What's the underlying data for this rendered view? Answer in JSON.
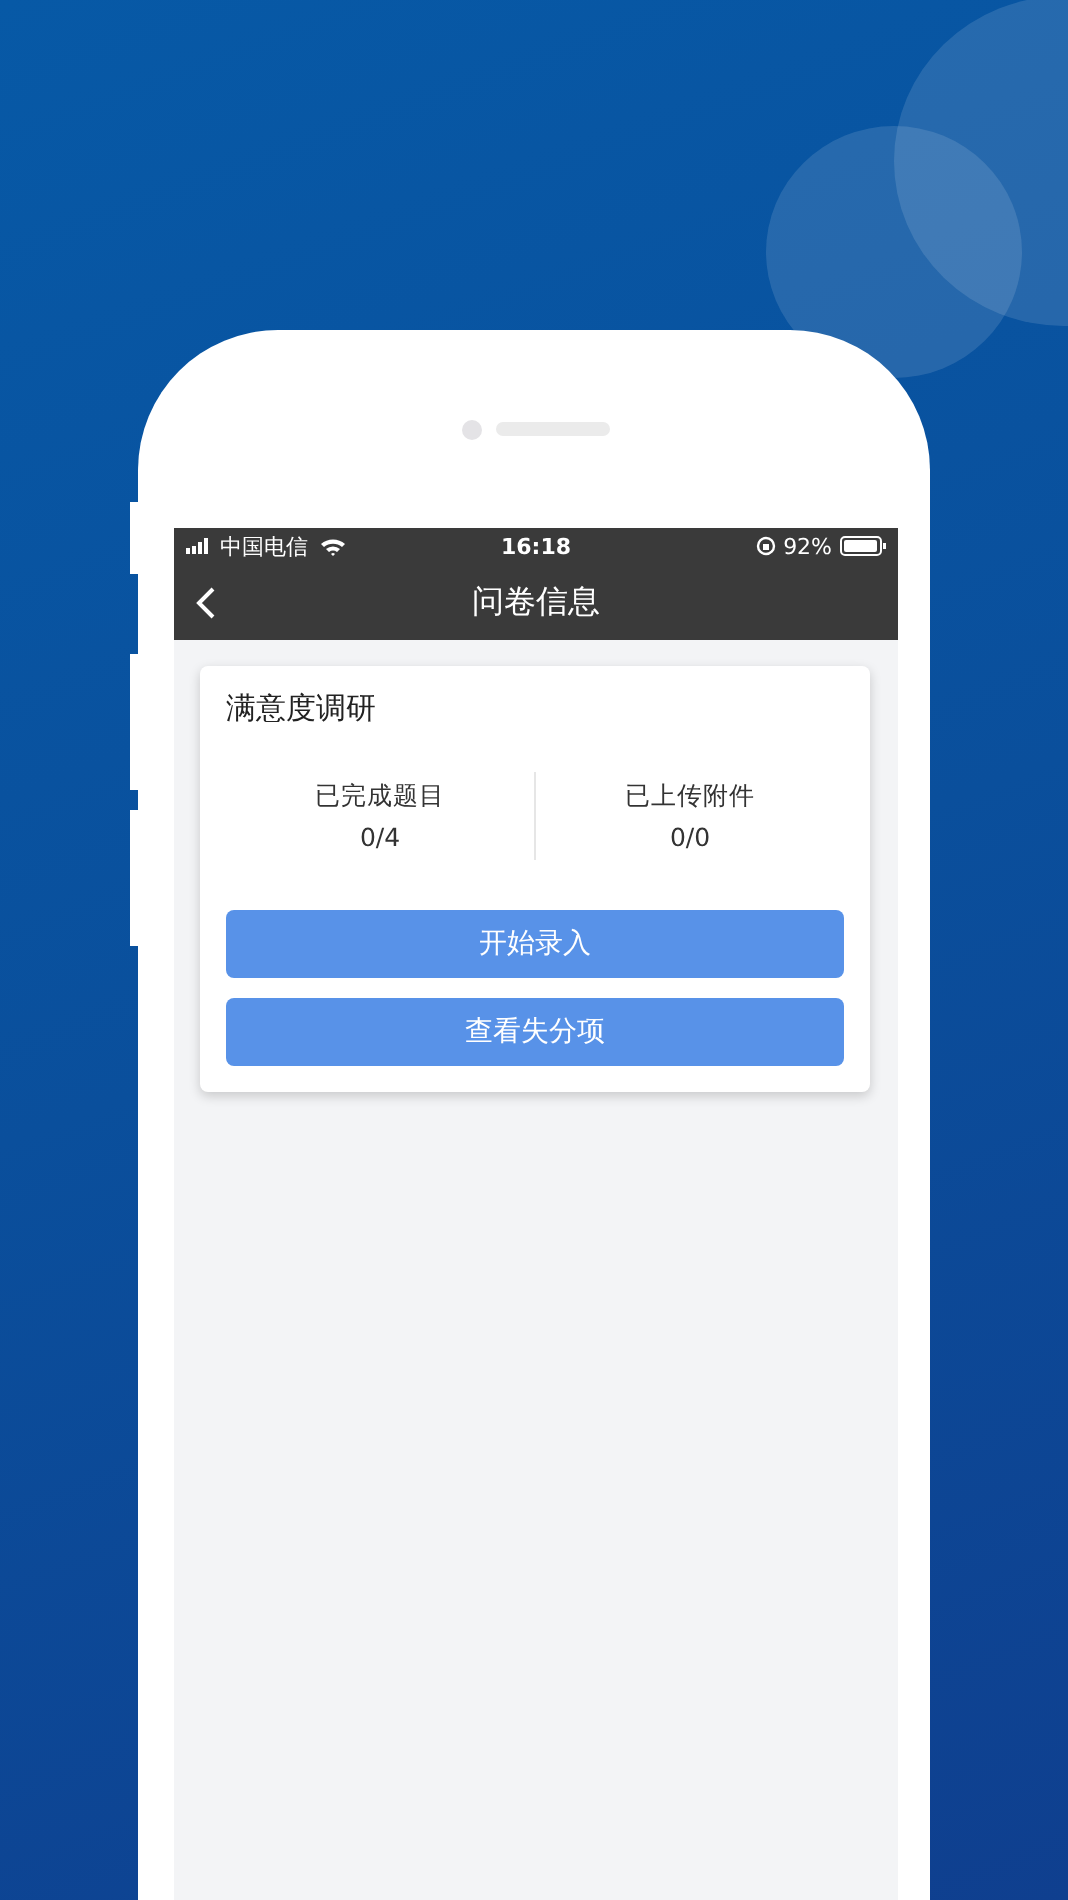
{
  "status_bar": {
    "carrier": "中国电信",
    "time": "16:18",
    "battery": "92%"
  },
  "nav": {
    "title": "问卷信息"
  },
  "card": {
    "title": "满意度调研",
    "stats": [
      {
        "label": "已完成题目",
        "value": "0/4"
      },
      {
        "label": "已上传附件",
        "value": "0/0"
      }
    ],
    "buttons": [
      "开始录入",
      "查看失分项"
    ]
  }
}
